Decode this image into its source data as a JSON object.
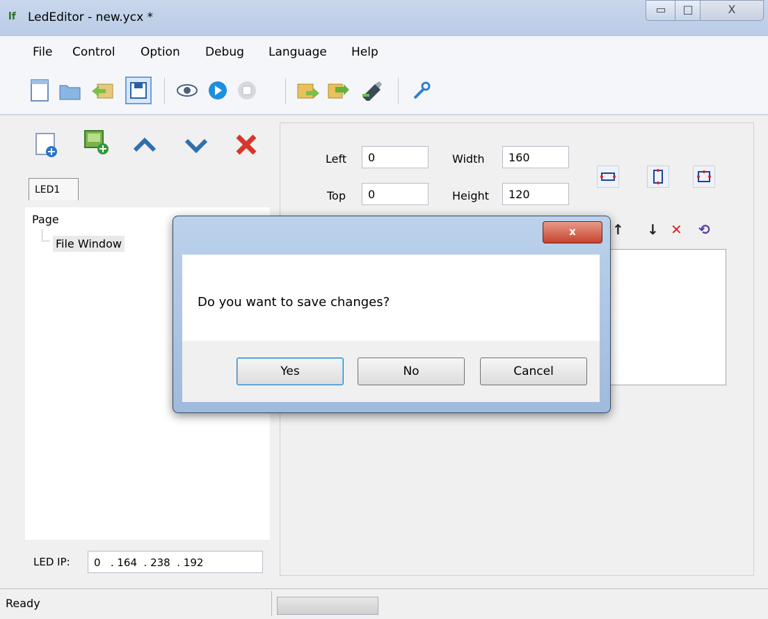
{
  "window": {
    "title": "LedEditor - new.ycx *",
    "app_icon": "lf-app-icon"
  },
  "window_controls": {
    "minimize": "▭",
    "maximize": "□",
    "close": "X"
  },
  "menu": [
    "File",
    "Control",
    "Option",
    "Debug",
    "Language",
    "Help"
  ],
  "toolbar": {
    "icons": [
      "new-file-icon",
      "open-folder-icon",
      "back-icon",
      "save-icon",
      "preview-eye-icon",
      "play-icon",
      "stop-icon",
      "export-icon",
      "send-icon",
      "usb-icon",
      "settings-wrench-icon"
    ]
  },
  "left_panel": {
    "actions": [
      "add-page-icon",
      "add-window-icon",
      "move-up-icon",
      "move-down-icon",
      "delete-icon"
    ],
    "led_tab": "LED1",
    "tree": {
      "root": "Page",
      "child": "File Window"
    },
    "ip_label": "LED IP:",
    "ip_value": "0   . 164  . 238  . 192"
  },
  "properties": {
    "left_label": "Left",
    "left_value": "0",
    "top_label": "Top",
    "top_value": "0",
    "width_label": "Width",
    "width_value": "160",
    "height_label": "Height",
    "height_value": "120"
  },
  "dialog": {
    "close": "x",
    "message": "Do you want to save changes?",
    "yes": "Yes",
    "no": "No",
    "cancel": "Cancel"
  },
  "status": {
    "text": "Ready"
  }
}
